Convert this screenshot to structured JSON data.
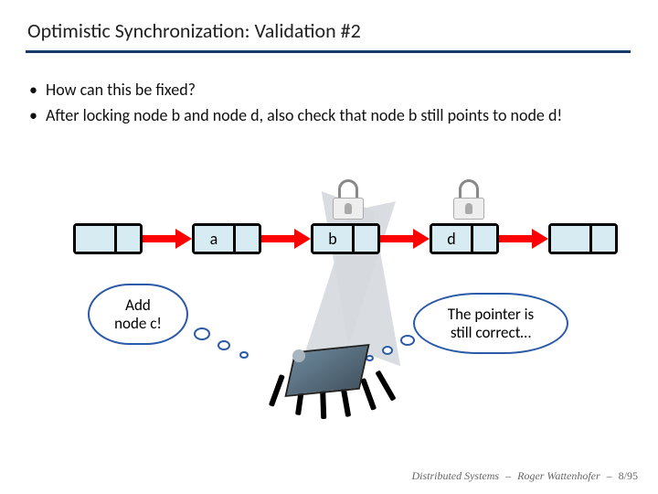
{
  "title": "Optimistic Synchronization: Validation #2",
  "bullets": [
    "How can this be fixed?",
    "After locking node b and node d, also check that node b still points to node d!"
  ],
  "nodes": {
    "n1": "",
    "n2": "a",
    "n3": "b",
    "n4": "d",
    "n5": ""
  },
  "clouds": {
    "left": "Add\nnode c!",
    "right": "The pointer is\nstill correct…"
  },
  "footer": {
    "course": "Distributed Systems",
    "author": "Roger Wattenhofer",
    "page": "8/95"
  }
}
